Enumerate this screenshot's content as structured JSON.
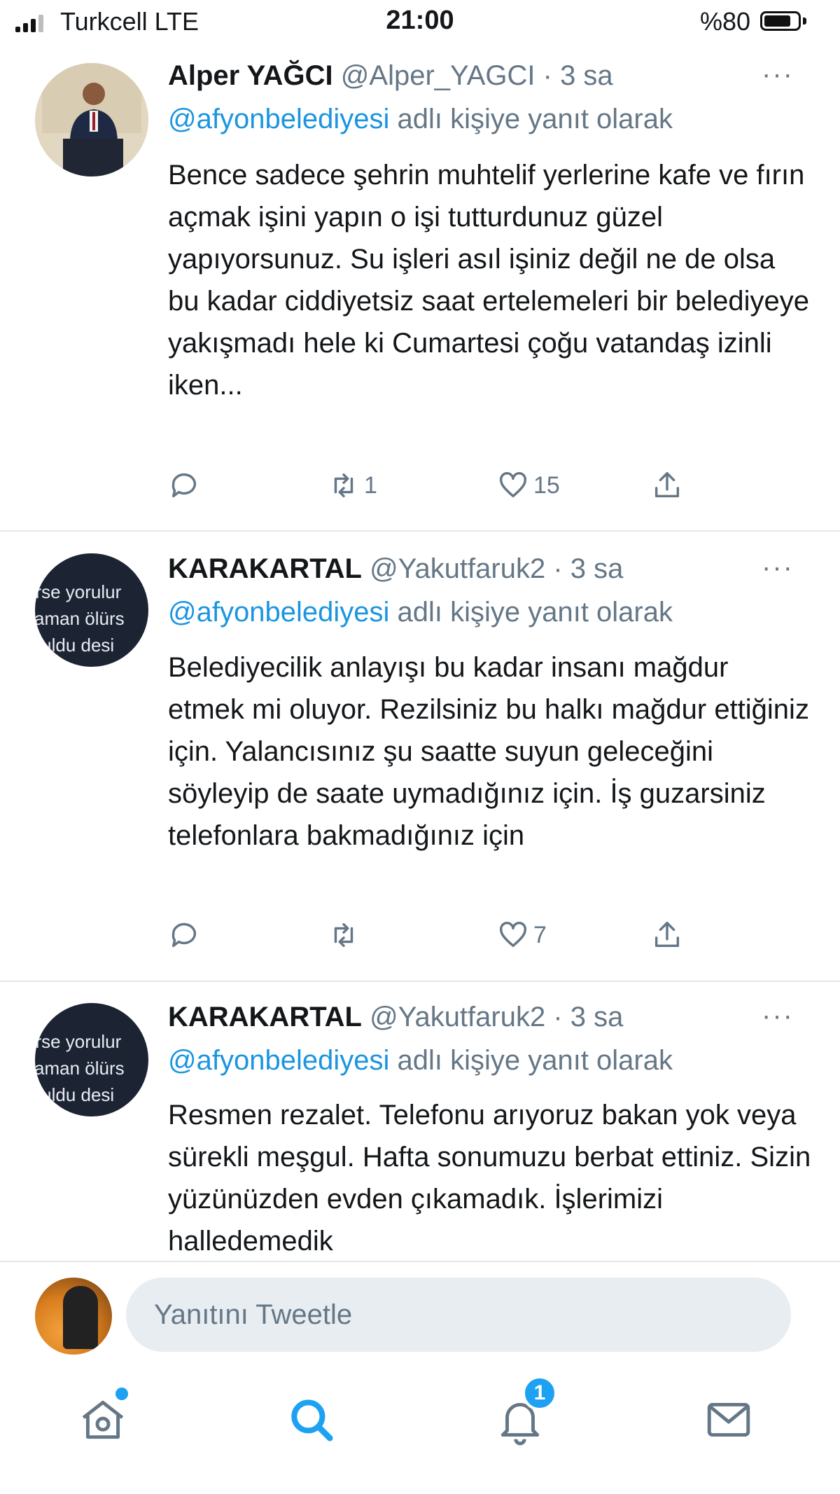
{
  "status_bar": {
    "carrier": "Turkcell  LTE",
    "time": "21:00",
    "battery": "%80"
  },
  "tweets": [
    {
      "name": "Alper YAĞCI",
      "handle": "@Alper_YAGCI · 3 sa",
      "reply_mention": "@afyonbelediyesi",
      "reply_suffix": " adlı kişiye yanıt olarak",
      "text": "Bence sadece şehrin muhtelif yerlerine kafe ve fırın açmak işini yapın o işi tutturdunuz güzel yapıyorsunuz. Su işleri asıl işiniz değil ne de olsa bu kadar ciddiyetsiz saat ertelemeleri bir belediyeye yakışmadı hele ki Cumartesi çoğu vatandaş izinli iken...",
      "retweets": "1",
      "likes": "15"
    },
    {
      "name": "KARAKARTAL",
      "handle": "@Yakutfaruk2 · 3 sa",
      "avatar_text": [
        "erse yorulur",
        "zaman ölürs",
        "oruldu desi"
      ],
      "reply_mention": "@afyonbelediyesi",
      "reply_suffix": " adlı kişiye yanıt olarak",
      "text": "Belediyecilik anlayışı bu kadar insanı mağdur etmek mi oluyor. Rezilsiniz bu halkı mağdur ettiğiniz için. Yalancısınız şu saatte suyun geleceğini söyleyip de saate uymadığınız için. İş guzarsiniz telefonlara bakmadığınız için",
      "retweets": "",
      "likes": "7"
    },
    {
      "name": "KARAKARTAL",
      "handle": "@Yakutfaruk2 · 3 sa",
      "avatar_text": [
        "erse yorulur",
        "zaman ölürs",
        "oruldu desi"
      ],
      "reply_mention": "@afyonbelediyesi",
      "reply_suffix": " adlı kişiye yanıt olarak",
      "text": "Resmen rezalet. Telefonu arıyoruz bakan yok veya sürekli meşgul. Hafta sonumuzu berbat ettiniz. Sizin yüzünüzden evden çıkamadık. İşlerimizi halledemedik"
    }
  ],
  "more_label": "···",
  "reply_box": {
    "placeholder": "Yanıtını Tweetle"
  },
  "tab_bar": {
    "icons": [
      "home-icon",
      "search-icon",
      "notifications-icon",
      "messages-icon"
    ],
    "notification_count": "1",
    "accent": "#1da1f2"
  },
  "colors": {
    "mention": "#1b95e0",
    "secondary": "#657786",
    "divider": "#e1e8ed"
  }
}
